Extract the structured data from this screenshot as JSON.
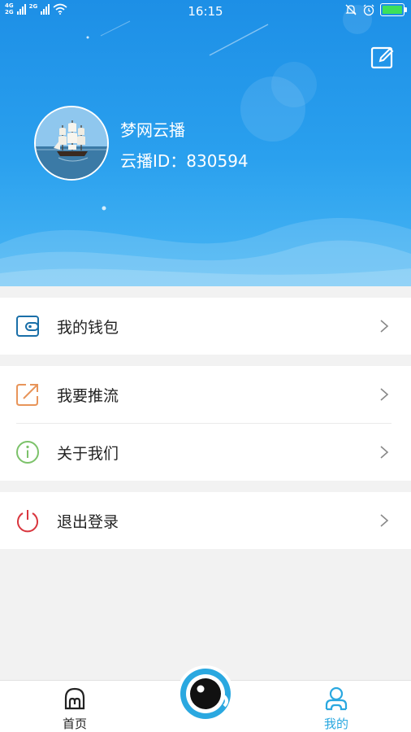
{
  "status_bar": {
    "net1": "4G",
    "net2": "2G",
    "net3": "2G",
    "time": "16:15",
    "battery_color": "#3ce05a"
  },
  "header": {
    "edit_icon": "edit-icon",
    "bg_color": "#1d8fe6"
  },
  "profile": {
    "name": "梦网云播",
    "id_line": "云播ID：830594"
  },
  "menu": [
    {
      "label": "我的钱包",
      "icon": "wallet-icon",
      "color": "#1a6fa8"
    },
    {
      "label": "我要推流",
      "icon": "share-arrow-icon",
      "color": "#e8955a"
    },
    {
      "label": "关于我们",
      "icon": "info-icon",
      "color": "#7cc26a"
    },
    {
      "label": "退出登录",
      "icon": "power-icon",
      "color": "#d9363e"
    }
  ],
  "tabbar": {
    "home_label": "首页",
    "mine_label": "我的",
    "active_color": "#2aa8e0"
  }
}
